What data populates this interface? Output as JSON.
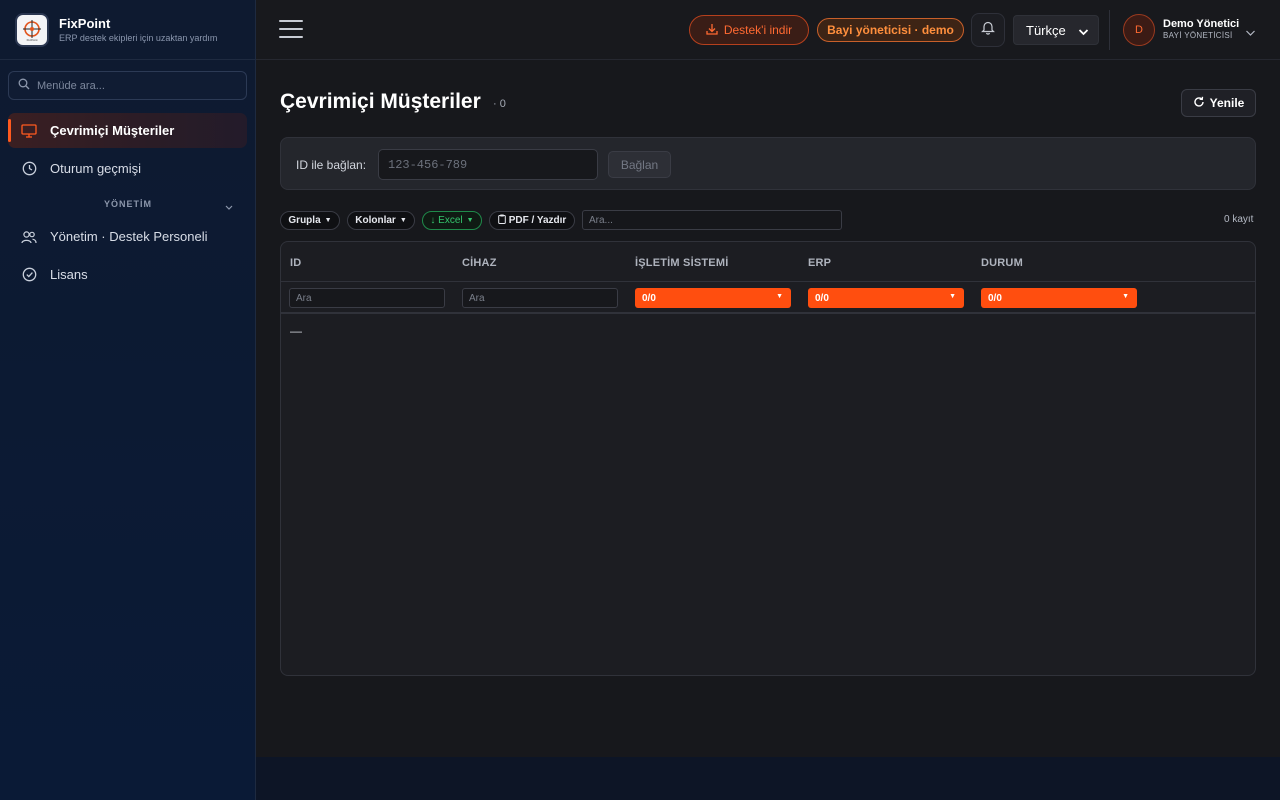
{
  "brand": {
    "name": "FixPoint",
    "tagline": "ERP destek ekipleri için uzaktan yardım",
    "logo_text": "FixPoint"
  },
  "sidebar": {
    "search_placeholder": "Menüde ara...",
    "items": [
      {
        "label": "Çevrimiçi Müşteriler",
        "icon": "monitor-icon",
        "active": true
      },
      {
        "label": "Oturum geçmişi",
        "icon": "clock-icon",
        "active": false
      }
    ],
    "section": {
      "label": "YÖNETİM"
    },
    "admin_items": [
      {
        "label": "Yönetim · Destek Personeli",
        "icon": "users-icon"
      },
      {
        "label": "Lisans",
        "icon": "check-circle-icon"
      }
    ]
  },
  "topbar": {
    "download_label": "Destek'i indir",
    "role_badge": "Bayi yöneticisi · demo",
    "language": "Türkçe",
    "user": {
      "initial": "D",
      "name": "Demo Yönetici",
      "role": "BAYİ YÖNETİCİSİ"
    }
  },
  "page": {
    "title": "Çevrimiçi Müşteriler",
    "count": "· 0",
    "refresh_label": "Yenile"
  },
  "connect": {
    "label": "ID ile bağlan:",
    "placeholder": "123-456-789",
    "button": "Bağlan"
  },
  "toolbar": {
    "group": "Grupla",
    "columns": "Kolonlar",
    "excel": "↓ Excel",
    "pdf": "PDF / Yazdır",
    "search_placeholder": "Ara...",
    "record_count": "0 kayıt"
  },
  "table": {
    "columns": [
      "ID",
      "CİHAZ",
      "İŞLETİM SİSTEMİ",
      "ERP",
      "DURUM"
    ],
    "filter_placeholder": "Ara",
    "select_values": [
      "0/0",
      "0/0",
      "0/0"
    ],
    "empty_text": "—"
  },
  "colors": {
    "accent": "#ff4e0f",
    "excel": "#34c46c"
  }
}
